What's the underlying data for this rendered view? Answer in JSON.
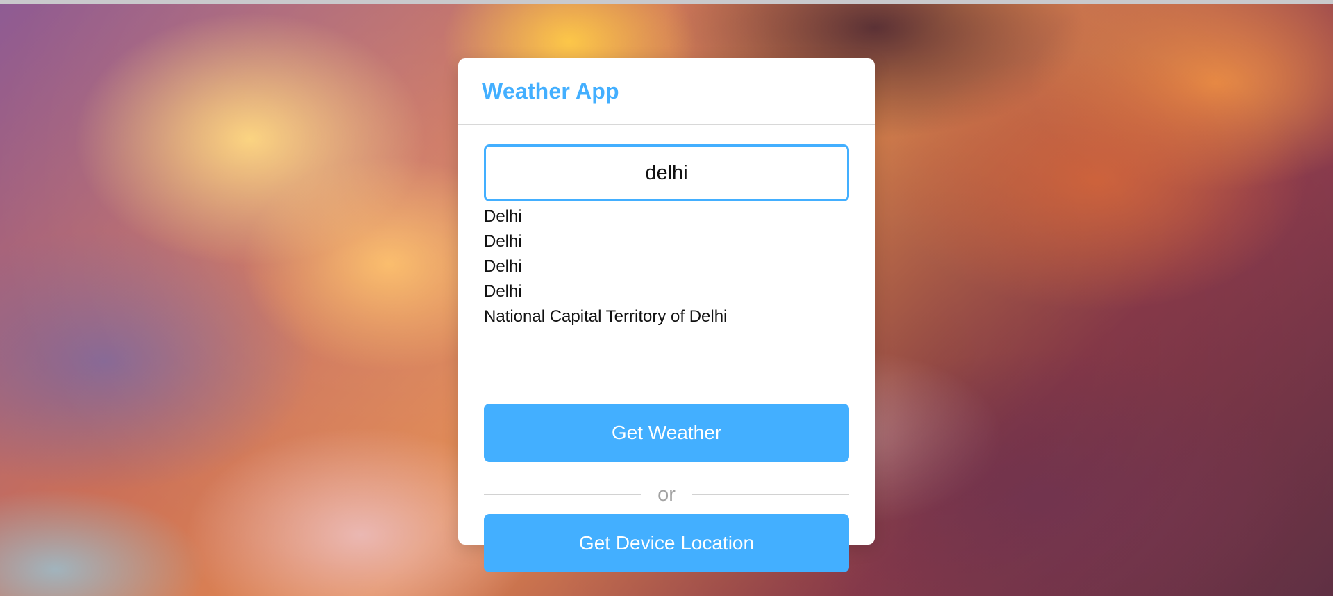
{
  "app": {
    "title": "Weather App"
  },
  "search": {
    "value": "delhi"
  },
  "suggestions": [
    "Delhi",
    "Delhi",
    "Delhi",
    "Delhi",
    "National Capital Territory of Delhi"
  ],
  "buttons": {
    "get_weather": "Get Weather",
    "or": "or",
    "get_device_location": "Get Device Location"
  },
  "colors": {
    "accent": "#43afff",
    "divider_text": "#a2a2a2"
  }
}
